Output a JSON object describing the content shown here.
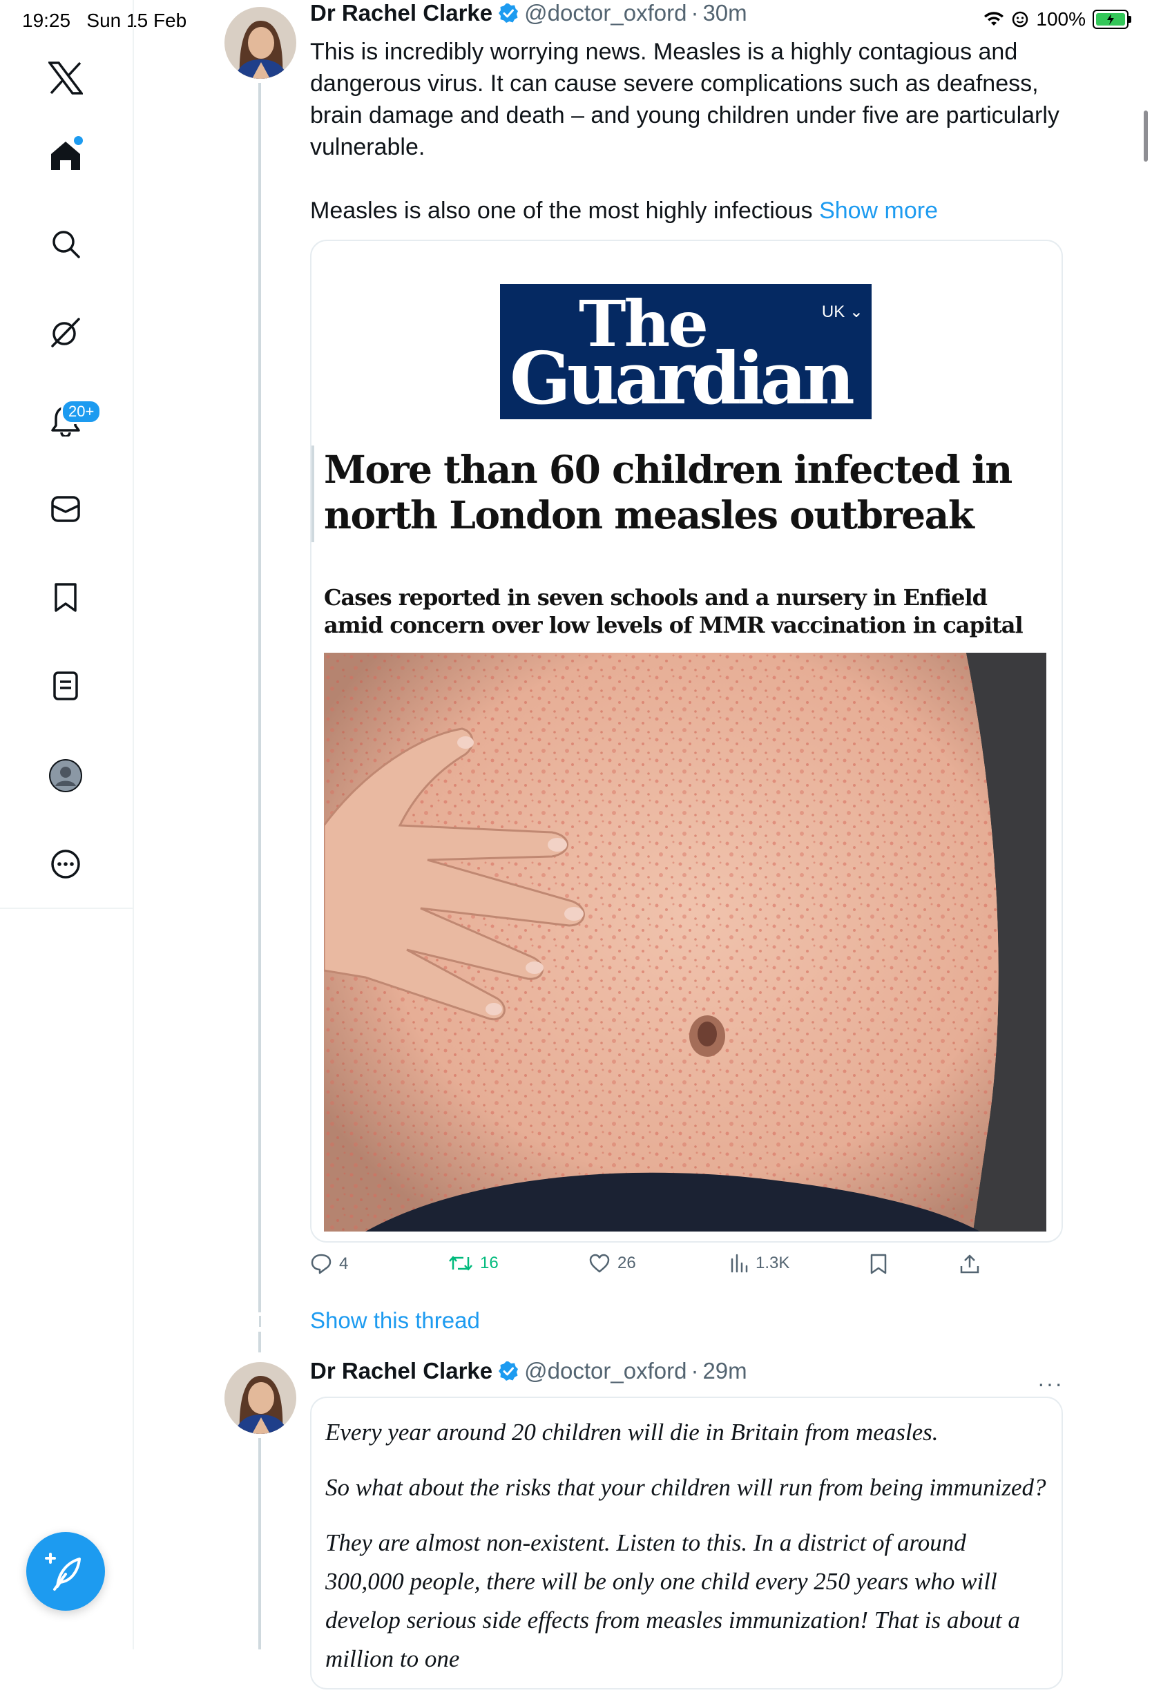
{
  "status_bar": {
    "time": "19:25",
    "date": "Sun 15 Feb",
    "battery": "100%",
    "battery_color": "#34c759"
  },
  "sidebar": {
    "items": [
      {
        "name": "x-logo-icon"
      },
      {
        "name": "home-icon"
      },
      {
        "name": "search-icon"
      },
      {
        "name": "grok-icon"
      },
      {
        "name": "notifications-icon",
        "badge": "20+"
      },
      {
        "name": "messages-icon"
      },
      {
        "name": "bookmarks-icon"
      },
      {
        "name": "lists-icon"
      },
      {
        "name": "profile-icon"
      },
      {
        "name": "more-icon"
      }
    ],
    "compose_icon": "compose-feather-icon",
    "accent_color": "#1d9bf0"
  },
  "tweet1": {
    "name": "Dr Rachel Clarke",
    "handle": "@doctor_oxford",
    "dot": "·",
    "time": "30m",
    "text_p1": "This is incredibly worrying news. Measles is a highly contagious and dangerous virus. It can cause severe complications such as deafness, brain damage and death – and young children under five are particularly vulnerable.",
    "text_p2": "Measles is also one of the most highly infectious",
    "show_more": "Show more",
    "card": {
      "logo_line1": "The",
      "logo_line2": "Guardian",
      "edition": "UK ⌄",
      "headline": "More than 60 children infected in north London measles outbreak",
      "standfirst": "Cases reported in seven schools and a nursery in Enfield amid concern over low levels of MMR vaccination in capital",
      "brand_color": "#052962"
    },
    "actions": {
      "replies": "4",
      "reposts": "16",
      "likes": "26",
      "views": "1.3K"
    }
  },
  "show_thread": "Show this thread",
  "tweet2": {
    "name": "Dr Rachel Clarke",
    "handle": "@doctor_oxford",
    "dot": "·",
    "time": "29m",
    "more": "···",
    "quote_p1": "Every year around 20 children will die in Britain from measles.",
    "quote_p2": "So what about the risks that your children will run from being immunized?",
    "quote_p3": "They are almost non-existent. Listen to this. In a district of around 300,000 people, there will be only one child every 250 years who will develop serious side effects from measles immunization! That is about a million to one"
  }
}
